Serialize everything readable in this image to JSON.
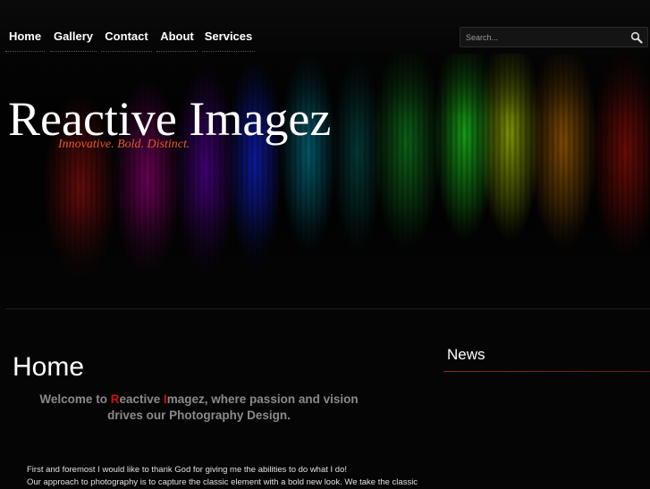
{
  "nav": {
    "items": [
      {
        "label": "Home"
      },
      {
        "label": "Gallery"
      },
      {
        "label": "Contact"
      },
      {
        "label": "About"
      },
      {
        "label": "Services"
      }
    ],
    "search_placeholder": "Search..."
  },
  "banner": {
    "title": "Reactive Imagez",
    "tagline": "Innovative. Bold. Distinct."
  },
  "main": {
    "title": "Home",
    "welcome": {
      "prefix": "Welcome to ",
      "r_letter": "R",
      "word1_rest": "eactive ",
      "i_letter": "I",
      "word2_rest": "magez, where passion and vision",
      "line2": "drives our Photography Design."
    },
    "paragraph_line1": "First and foremost I would like to thank God for giving me the abilities to do what I do!",
    "paragraph_line2": "Our approach to photography is to capture the classic element with a bold new look. We take the classic"
  },
  "sidebar": {
    "news_heading": "News"
  },
  "colors": {
    "accent_red": "#d01010",
    "tagline_orange": "#e05a2a"
  }
}
